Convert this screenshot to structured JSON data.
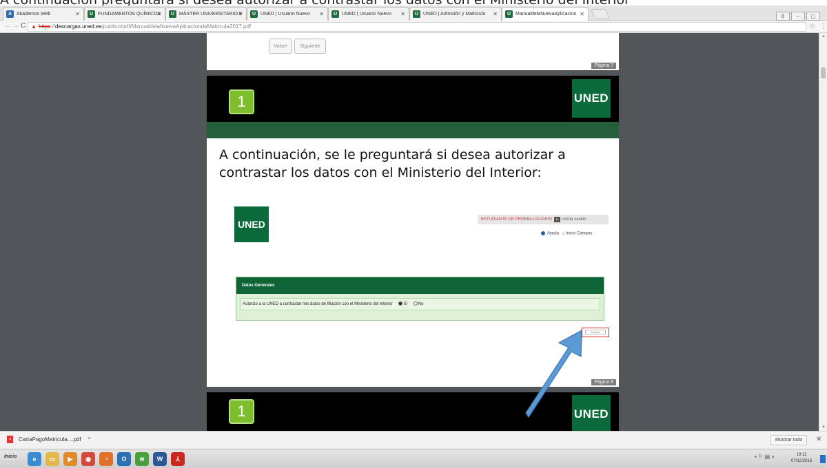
{
  "caption": "A continuación preguntará si desea autorizar a contrastar los datos con el Ministerio del Interior",
  "tabs": [
    {
      "label": "Akademos Web",
      "fav": "A",
      "fav_color": "#2a6db3"
    },
    {
      "label": "FUNDAMENTOS QUÍMICOS",
      "fav": "U",
      "fav_color": "#1d6e3c"
    },
    {
      "label": "MÁSTER UNIVERSITARIO E",
      "fav": "U",
      "fav_color": "#1d6e3c"
    },
    {
      "label": "UNED | Usuario Nuevo",
      "fav": "U",
      "fav_color": "#1d6e3c"
    },
    {
      "label": "UNED | Usuario Nuevo",
      "fav": "U",
      "fav_color": "#1d6e3c"
    },
    {
      "label": "UNED | Admisión y Matrícula",
      "fav": "U",
      "fav_color": "#1d6e3c"
    },
    {
      "label": "ManualdelaNuevaAplicacion",
      "fav": "U",
      "fav_color": "#1d6e3c"
    }
  ],
  "address": {
    "warn": "▲",
    "proto": "https",
    "sep": "://",
    "host": "descargas.uned.es",
    "path": "/publico/pdf/ManualdelaNuevaAplicaciondeMatricula2017.pdf"
  },
  "page1": {
    "btn_back": "Volver",
    "btn_next": "Siguiente",
    "page_label": "Página 7"
  },
  "page2": {
    "step": "1",
    "logo": "UNED",
    "heading": "A continuación, se le preguntará si desea autorizar a contrastar los datos con el Ministerio del Interior:",
    "user": "ESTUDIANTE DE PRUEBA USUARIO",
    "logout": "cerrar sesión",
    "help": "Ayuda",
    "campus": "Inicio Campus",
    "form_title": "Datos Generales",
    "form_question": "Autorizo a la UNED a contrastar mis datos de filiación con el Ministerio del Interior",
    "opt_yes": "Sí",
    "opt_no": "No",
    "accept": "Aceptar",
    "page_label": "Página 8"
  },
  "page3": {
    "step": "1",
    "logo": "UNED"
  },
  "downloads": {
    "file": "CartaPagoMatricula....pdf",
    "show_all": "Mostrar todo"
  },
  "taskbar": {
    "start": "Inicio",
    "time": "19:12",
    "date": "07/12/2016"
  },
  "colors": {
    "uned_green": "#0b6a3a",
    "step_green": "#7ebd2e",
    "arrow_blue": "#5b9bd5"
  }
}
